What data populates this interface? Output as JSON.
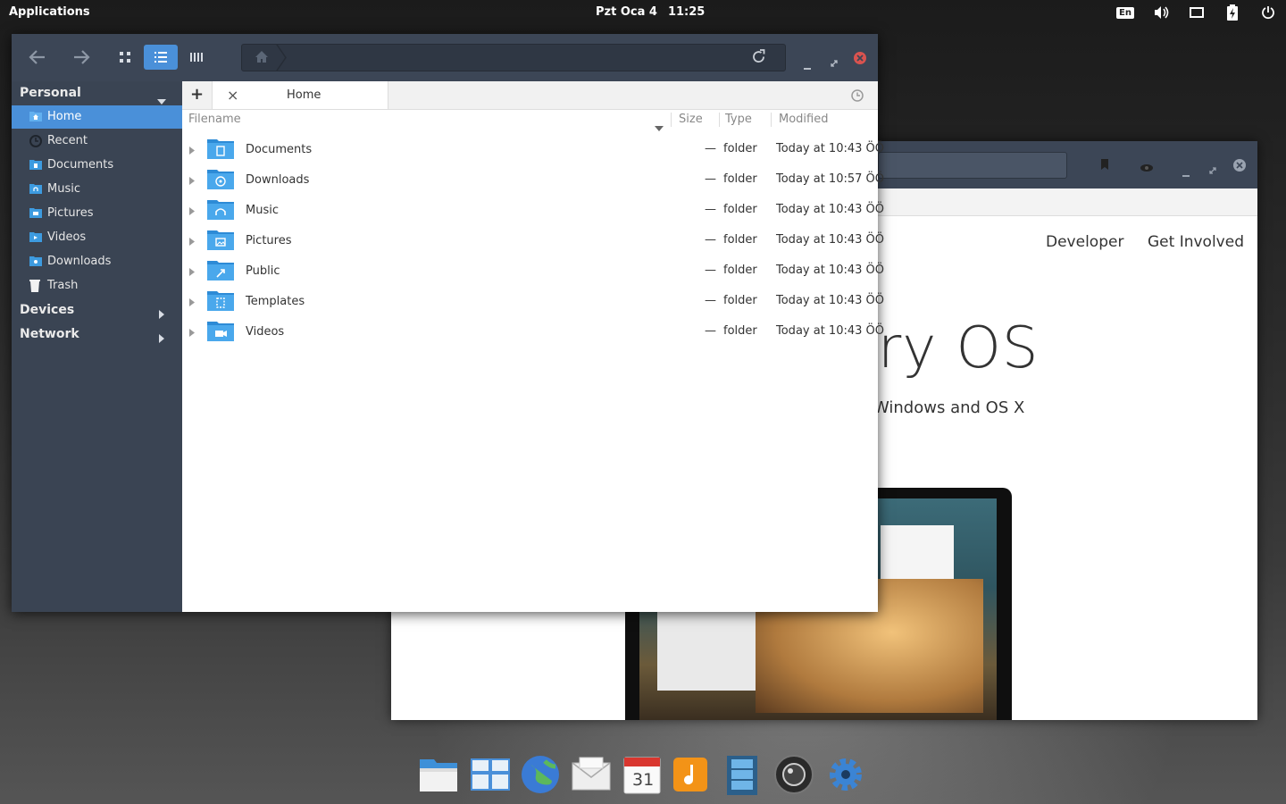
{
  "panel": {
    "applications": "Applications",
    "date": "Pzt Oca  4",
    "time": "11:25",
    "tray": [
      "keyboard-layout",
      "volume",
      "display",
      "battery",
      "power"
    ],
    "keyboard_label": "En"
  },
  "browser": {
    "nav": [
      "Developer",
      "Get Involved"
    ],
    "title_fragment": "ry OS",
    "subtitle_fragment": "Windows and OS X"
  },
  "file_manager": {
    "toolbar": {
      "back": "back",
      "forward": "forward",
      "view_modes": [
        "icon-view",
        "list-view",
        "column-view"
      ],
      "active_view": "list-view"
    },
    "sidebar": {
      "personal": "Personal",
      "items": [
        {
          "label": "Home",
          "icon": "home-folder",
          "selected": true
        },
        {
          "label": "Recent",
          "icon": "recent-clock"
        },
        {
          "label": "Documents",
          "icon": "documents-folder"
        },
        {
          "label": "Music",
          "icon": "music-folder"
        },
        {
          "label": "Pictures",
          "icon": "pictures-folder"
        },
        {
          "label": "Videos",
          "icon": "videos-folder"
        },
        {
          "label": "Downloads",
          "icon": "downloads-folder"
        },
        {
          "label": "Trash",
          "icon": "trash"
        }
      ],
      "devices": "Devices",
      "network": "Network"
    },
    "tab": {
      "new": "+",
      "close": "×",
      "label": "Home"
    },
    "columns": {
      "filename": "Filename",
      "size": "Size",
      "type": "Type",
      "modified": "Modified"
    },
    "rows": [
      {
        "name": "Documents",
        "size": "—",
        "type": "folder",
        "modified": "Today at 10:43 ÖÖ"
      },
      {
        "name": "Downloads",
        "size": "—",
        "type": "folder",
        "modified": "Today at 10:57 ÖÖ"
      },
      {
        "name": "Music",
        "size": "—",
        "type": "folder",
        "modified": "Today at 10:43 ÖÖ"
      },
      {
        "name": "Pictures",
        "size": "—",
        "type": "folder",
        "modified": "Today at 10:43 ÖÖ"
      },
      {
        "name": "Public",
        "size": "—",
        "type": "folder",
        "modified": "Today at 10:43 ÖÖ"
      },
      {
        "name": "Templates",
        "size": "—",
        "type": "folder",
        "modified": "Today at 10:43 ÖÖ"
      },
      {
        "name": "Videos",
        "size": "—",
        "type": "folder",
        "modified": "Today at 10:43 ÖÖ"
      }
    ]
  },
  "dock": {
    "apps": [
      "files",
      "multitasking",
      "web-browser",
      "mail",
      "calendar",
      "music",
      "videos",
      "photos-camera",
      "settings"
    ],
    "calendar_day": "31"
  },
  "colors": {
    "accent": "#4a90d9",
    "header": "#3c4656",
    "sidebar": "#3a4453",
    "close": "#d9534f",
    "folder": "#3d9be0"
  }
}
